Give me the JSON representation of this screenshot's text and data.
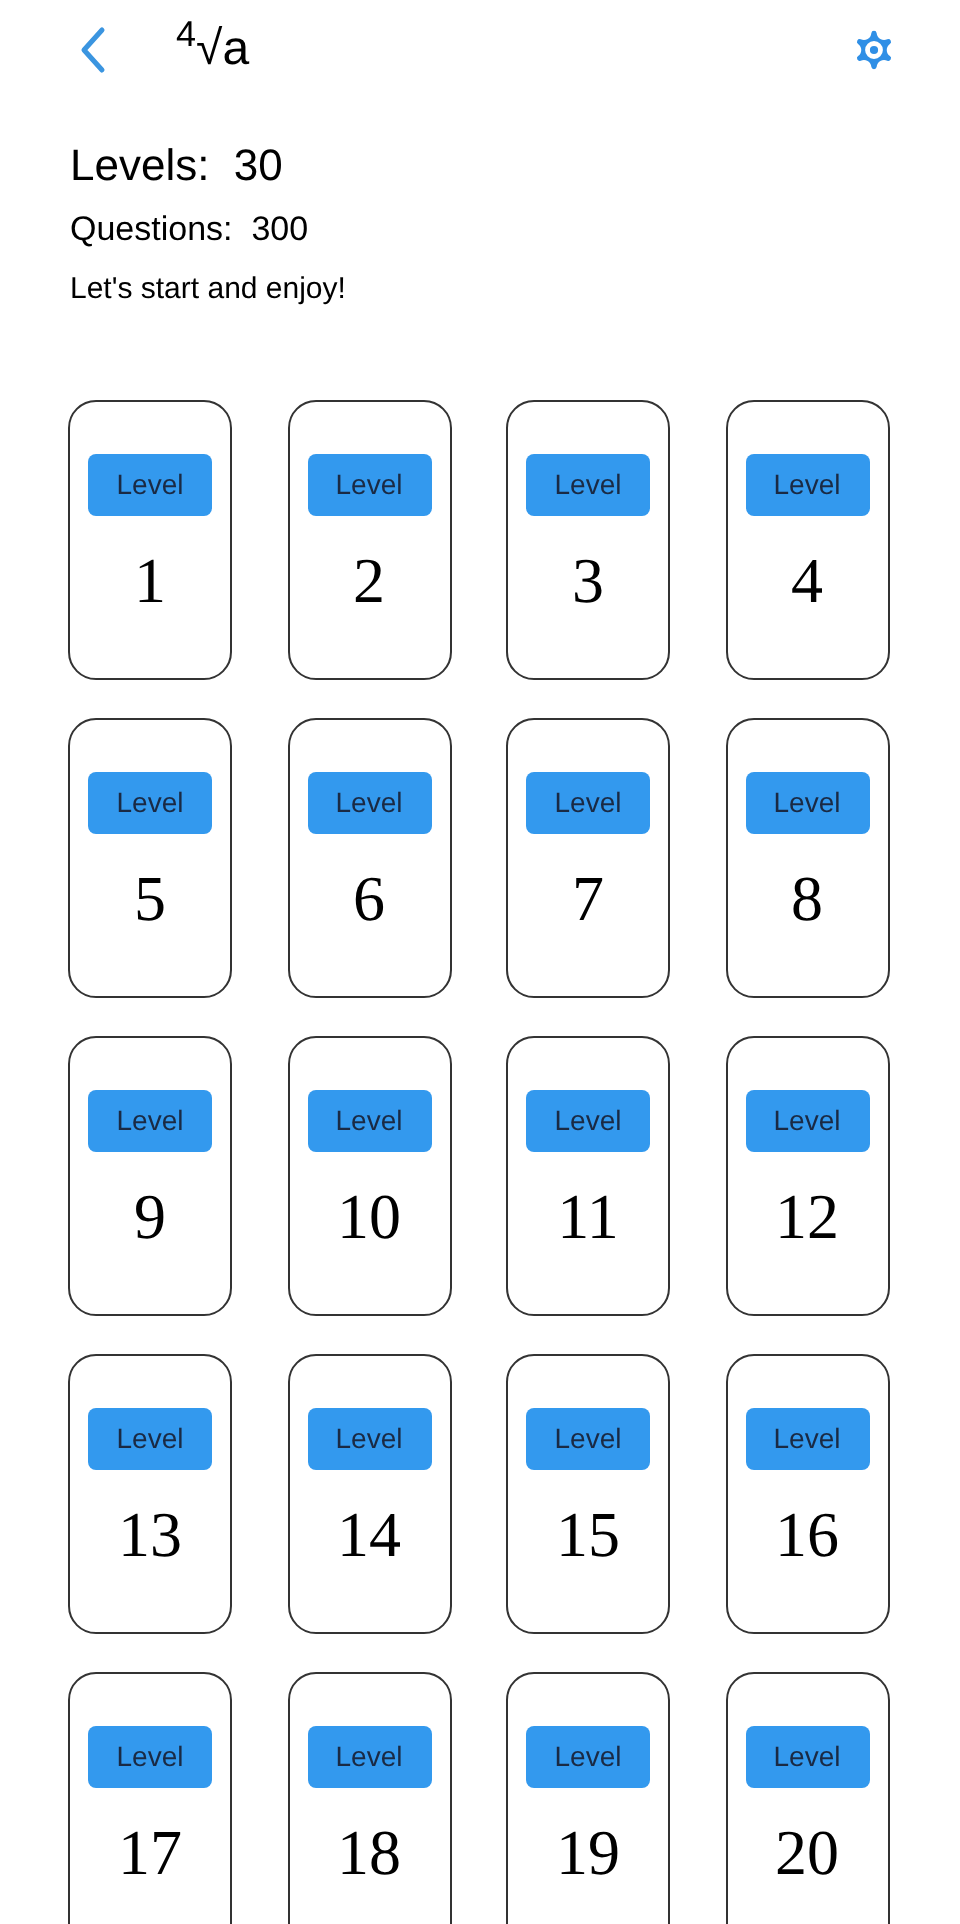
{
  "header": {
    "title": "$^{4}$√a"
  },
  "summary": {
    "levels": "Levels:  30",
    "questions": "Questions:  300",
    "tagline": "Let's start and enjoy!"
  },
  "levels": [
    {
      "label": "Level",
      "number": "1"
    },
    {
      "label": "Level",
      "number": "2"
    },
    {
      "label": "Level",
      "number": "3"
    },
    {
      "label": "Level",
      "number": "4"
    },
    {
      "label": "Level",
      "number": "5"
    },
    {
      "label": "Level",
      "number": "6"
    },
    {
      "label": "Level",
      "number": "7"
    },
    {
      "label": "Level",
      "number": "8"
    },
    {
      "label": "Level",
      "number": "9"
    },
    {
      "label": "Level",
      "number": "10"
    },
    {
      "label": "Level",
      "number": "11"
    },
    {
      "label": "Level",
      "number": "12"
    },
    {
      "label": "Level",
      "number": "13"
    },
    {
      "label": "Level",
      "number": "14"
    },
    {
      "label": "Level",
      "number": "15"
    },
    {
      "label": "Level",
      "number": "16"
    },
    {
      "label": "Level",
      "number": "17"
    },
    {
      "label": "Level",
      "number": "18"
    },
    {
      "label": "Level",
      "number": "19"
    },
    {
      "label": "Level",
      "number": "20"
    }
  ]
}
